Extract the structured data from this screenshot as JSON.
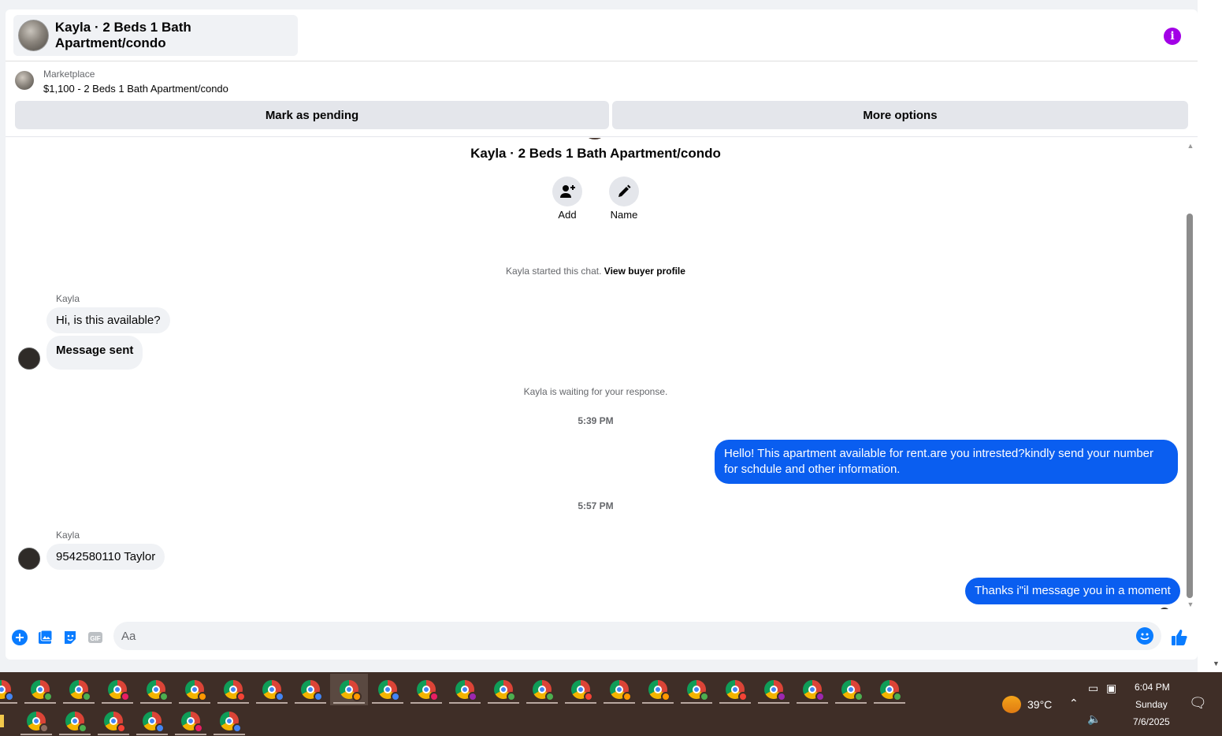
{
  "header": {
    "title": "Kayla · 2 Beds 1 Bath Apartment/condo",
    "info_icon": "info-icon",
    "info_color": "#a200e6"
  },
  "listing": {
    "label": "Marketplace",
    "price_title": "$1,100 - 2 Beds 1 Bath Apartment/condo",
    "mark_pending": "Mark as pending",
    "more_options": "More options"
  },
  "chat": {
    "name": "Kayla · 2 Beds 1 Bath Apartment/condo",
    "add_label": "Add",
    "name_label": "Name",
    "started_text": "Kayla started this chat.",
    "view_profile": "View buyer profile",
    "waiting_text": "Kayla is waiting for your response.",
    "messages": [
      {
        "sender": "Kayla",
        "text": "Hi, is this available?"
      },
      {
        "text": "Message sent"
      }
    ],
    "time_1": "5:39 PM",
    "out_1": "Hello! This apartment available for rent.are you intrested?kindly send your number for schdule and other information.",
    "time_2": "5:57 PM",
    "sender_2": "Kayla",
    "in_3": "9542580110 Taylor",
    "out_2": "Thanks i\"il message you in a moment",
    "accent_color": "#0a5ef0"
  },
  "composer": {
    "placeholder": "Aa",
    "gif_label": "GIF",
    "icons": [
      "plus-icon",
      "photo-icon",
      "sticker-icon",
      "gif-icon",
      "emoji-icon",
      "thumbs-up-icon"
    ]
  },
  "taskbar": {
    "temperature": "39°C",
    "time": "6:04 PM",
    "day": "Sunday",
    "date": "7/6/2025",
    "row1_badge_colors": [
      "#4285f4",
      "#4caf50",
      "#4caf50",
      "#e91e63",
      "#4caf50",
      "#ff9800",
      "#f44336",
      "#4285f4",
      "#4285f4",
      "#ff9800",
      "#4285f4",
      "#e91e63",
      "#9c27b0",
      "#4caf50",
      "#4caf50",
      "#f44336",
      "#ff9800",
      "#ff9800",
      "#4caf50",
      "#f44336",
      "#9c27b0",
      "#9c27b0",
      "#4caf50",
      "#4caf50"
    ],
    "row2_badge_colors": [
      "#8d6e63",
      "#4caf50",
      "#f44336",
      "#4285f4",
      "#e91e63",
      "#4285f4"
    ]
  }
}
